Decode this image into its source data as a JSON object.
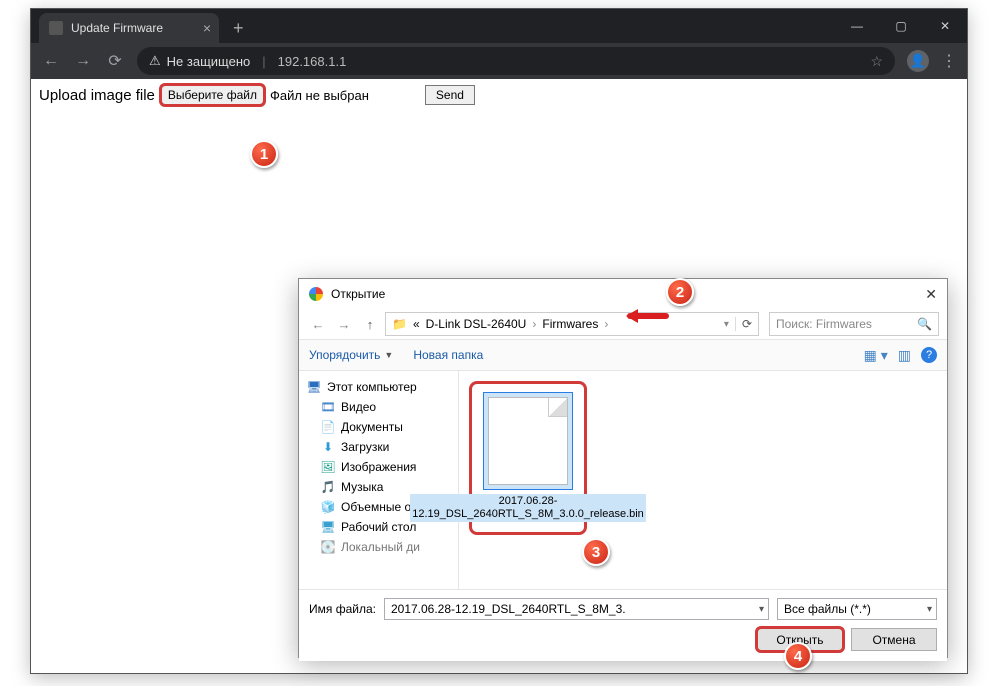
{
  "browser": {
    "tab_title": "Update Firmware",
    "security_label": "Не защищено",
    "url": "192.168.1.1"
  },
  "page": {
    "upload_label": "Upload image file",
    "choose_file_btn": "Выберите файл",
    "file_status": "Файл не выбран",
    "send_btn": "Send"
  },
  "dialog": {
    "title": "Открытие",
    "breadcrumb_prefix": "«",
    "breadcrumb_parent": "D-Link DSL-2640U",
    "breadcrumb_current": "Firmwares",
    "search_placeholder": "Поиск: Firmwares",
    "toolbar_organize": "Упорядочить",
    "toolbar_newfolder": "Новая папка",
    "tree": {
      "root": "Этот компьютер",
      "items": [
        "Видео",
        "Документы",
        "Загрузки",
        "Изображения",
        "Музыка",
        "Объемные объ",
        "Рабочий стол",
        "Локальный ди"
      ]
    },
    "file_name_display": "2017.06.28-12.19_DSL_2640RTL_S_8M_3.0.0_release.bin",
    "filename_label": "Имя файла:",
    "filename_value": "2017.06.28-12.19_DSL_2640RTL_S_8M_3.",
    "filter_label": "Все файлы (*.*)",
    "open_btn": "Открыть",
    "cancel_btn": "Отмена"
  },
  "badges": {
    "b1": "1",
    "b2": "2",
    "b3": "3",
    "b4": "4"
  }
}
